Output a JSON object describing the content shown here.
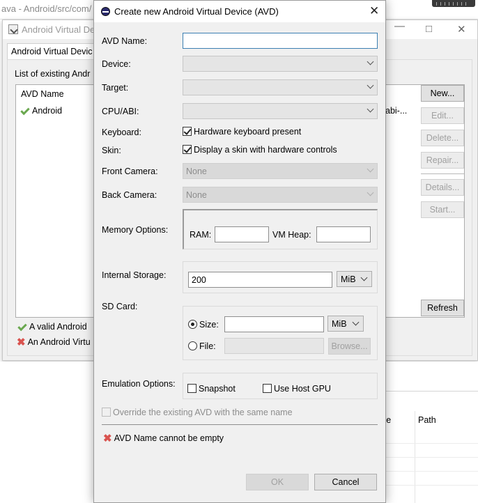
{
  "background": {
    "eclipse_title": "ava - Android/src/com/",
    "manager": {
      "title": "Android Virtual De",
      "tab_label": "Android Virtual Devic",
      "list_label": "List of existing Andr",
      "column_name": "AVD Name",
      "row_name": "Android",
      "row_abi": "abi-...",
      "buttons": {
        "new": "New...",
        "edit": "Edit...",
        "delete": "Delete...",
        "repair": "Repair...",
        "details": "Details...",
        "start": "Start...",
        "refresh": "Refresh"
      },
      "legend_valid": "A valid Android",
      "legend_invalid": "An Android Virtu"
    },
    "table": {
      "col_ce": "ce",
      "col_path": "Path"
    }
  },
  "dialog": {
    "title": "Create new Android Virtual Device (AVD)",
    "avd_name": {
      "label": "AVD Name:",
      "value": ""
    },
    "device": {
      "label": "Device:",
      "value": ""
    },
    "target": {
      "label": "Target:",
      "value": ""
    },
    "cpu_abi": {
      "label": "CPU/ABI:",
      "value": ""
    },
    "keyboard": {
      "label": "Keyboard:",
      "option": "Hardware keyboard present",
      "checked": true
    },
    "skin": {
      "label": "Skin:",
      "option": "Display a skin with hardware controls",
      "checked": true
    },
    "front_camera": {
      "label": "Front Camera:",
      "value": "None"
    },
    "back_camera": {
      "label": "Back Camera:",
      "value": "None"
    },
    "memory": {
      "label": "Memory Options:",
      "ram_label": "RAM:",
      "ram_value": "",
      "vmheap_label": "VM Heap:",
      "vmheap_value": ""
    },
    "internal_storage": {
      "label": "Internal Storage:",
      "value": "200",
      "unit": "MiB"
    },
    "sd_card": {
      "label": "SD Card:",
      "size_label": "Size:",
      "size_value": "",
      "size_unit": "MiB",
      "file_label": "File:",
      "file_value": "",
      "browse": "Browse..."
    },
    "emulation": {
      "label": "Emulation Options:",
      "snapshot": "Snapshot",
      "host_gpu": "Use Host GPU"
    },
    "override": "Override the existing AVD with the same name",
    "error": "AVD Name cannot be empty",
    "ok": "OK",
    "cancel": "Cancel"
  }
}
